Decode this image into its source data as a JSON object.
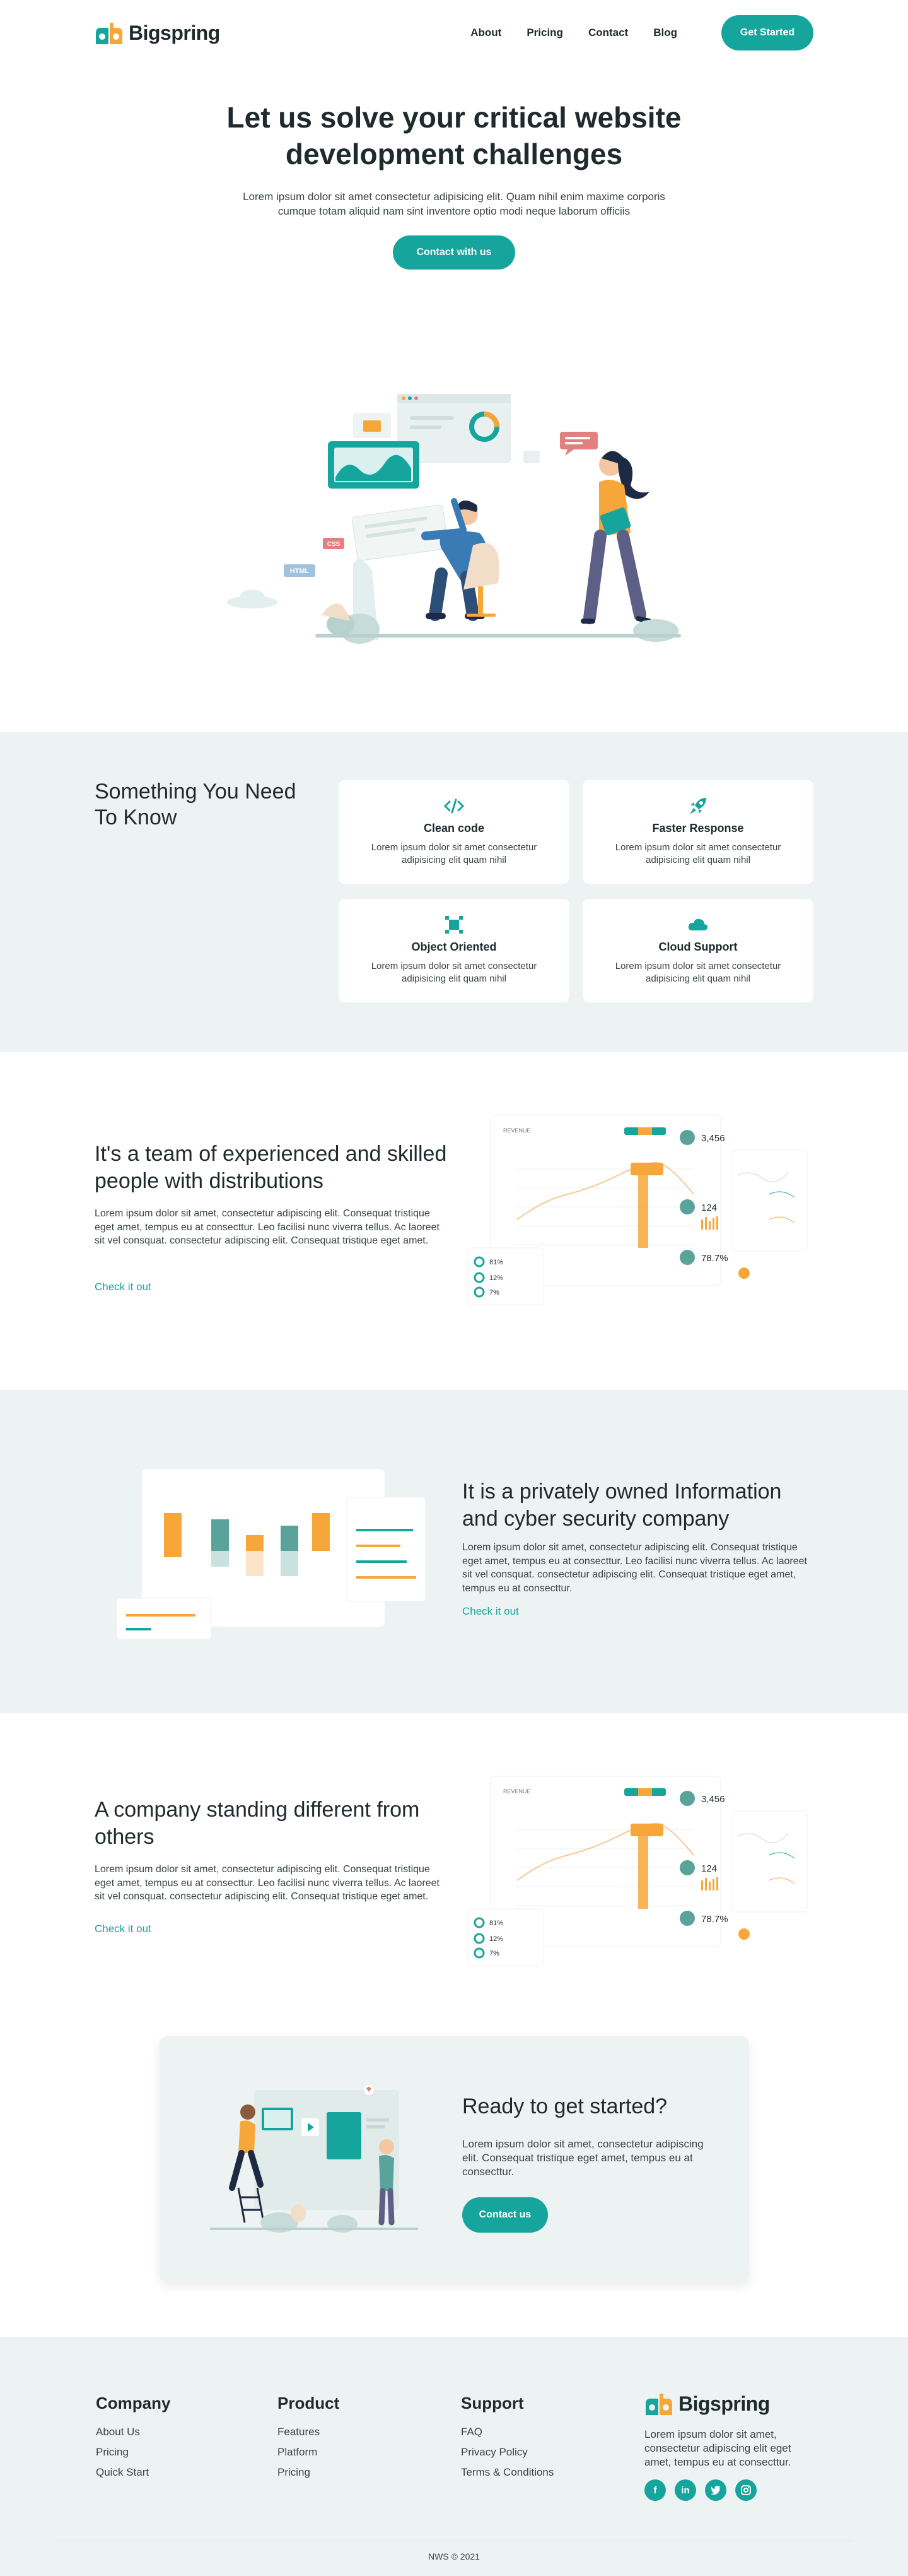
{
  "brand": {
    "name": "Bigspring"
  },
  "nav": {
    "links": [
      "About",
      "Pricing",
      "Contact",
      "Blog"
    ],
    "cta": "Get Started"
  },
  "hero": {
    "title": "Let us solve your critical website development challenges",
    "text": "Lorem ipsum dolor sit amet consectetur adipisicing elit. Quam nihil enim maxime corporis cumque totam aliquid nam sint inventore optio modi neque laborum officiis",
    "button": "Contact with us",
    "badges": {
      "css": "CSS",
      "html": "HTML"
    }
  },
  "features": {
    "title": "Something You Need To Know",
    "items": [
      {
        "title": "Clean code",
        "text": "Lorem ipsum dolor sit amet consectetur adipisicing elit quam nihil",
        "icon": "code-icon"
      },
      {
        "title": "Faster Response",
        "text": "Lorem ipsum dolor sit amet consectetur adipisicing elit quam nihil",
        "icon": "rocket-icon"
      },
      {
        "title": "Object Oriented",
        "text": "Lorem ipsum dolor sit amet consectetur adipisicing elit quam nihil",
        "icon": "object-icon"
      },
      {
        "title": "Cloud Support",
        "text": "Lorem ipsum dolor sit amet consectetur adipisicing elit quam nihil",
        "icon": "cloud-icon"
      }
    ]
  },
  "section1": {
    "title": "It's a team of experienced and skilled people with distributions",
    "text": "Lorem ipsum dolor sit amet, consectetur adipiscing elit. Consequat tristique eget amet, tempus eu at consecttur. Leo facilisi nunc viverra tellus. Ac laoreet sit vel consquat. consectetur adipiscing elit. Consequat tristique eget amet.",
    "link": "Check it out",
    "dashboard": {
      "label": "REVENUE",
      "stats": [
        "3,456",
        "124",
        "78.7%"
      ],
      "percents": [
        "81%",
        "12%",
        "7%"
      ]
    }
  },
  "section2": {
    "title": "It is a privately owned Information and cyber security company",
    "text": "Lorem ipsum dolor sit amet, consectetur adipiscing elit. Consequat tristique eget amet, tempus eu at consecttur. Leo facilisi nunc viverra tellus. Ac laoreet sit vel consquat. consectetur adipiscing elit. Consequat tristique eget amet, tempus eu at consecttur.",
    "link": "Check it out"
  },
  "section3": {
    "title": "A company standing different from others",
    "text": "Lorem ipsum dolor sit amet, consectetur adipiscing elit. Consequat tristique eget amet, tempus eu at consecttur. Leo facilisi nunc viverra tellus. Ac laoreet sit vel consquat. consectetur adipiscing elit. Consequat tristique eget amet.",
    "link": "Check it out",
    "dashboard": {
      "label": "REVENUE",
      "stats": [
        "3,456",
        "124",
        "78.7%"
      ],
      "percents": [
        "81%",
        "12%",
        "7%"
      ]
    }
  },
  "cta": {
    "title": "Ready to get started?",
    "text": "Lorem ipsum dolor sit amet, consectetur adipiscing elit. Consequat tristique eget amet, tempus eu at consecttur.",
    "button": "Contact us"
  },
  "footer": {
    "columns": [
      {
        "title": "Company",
        "links": [
          "About Us",
          "Pricing",
          "Quick Start"
        ]
      },
      {
        "title": "Product",
        "links": [
          "Features",
          "Platform",
          "Pricing"
        ]
      },
      {
        "title": "Support",
        "links": [
          "FAQ",
          "Privacy Policy",
          "Terms & Conditions"
        ]
      }
    ],
    "brand_text": "Lorem ipsum dolor sit amet, consectetur adipiscing elit eget amet, tempus eu at consecttur.",
    "socials": [
      "facebook-icon",
      "linkedin-icon",
      "twitter-icon",
      "instagram-icon"
    ],
    "copyright": "NWS © 2021"
  },
  "colors": {
    "accent": "#16a59c",
    "orange": "#f7a73a",
    "bg_soft": "#edf3f2",
    "text": "#1e2a2c"
  }
}
